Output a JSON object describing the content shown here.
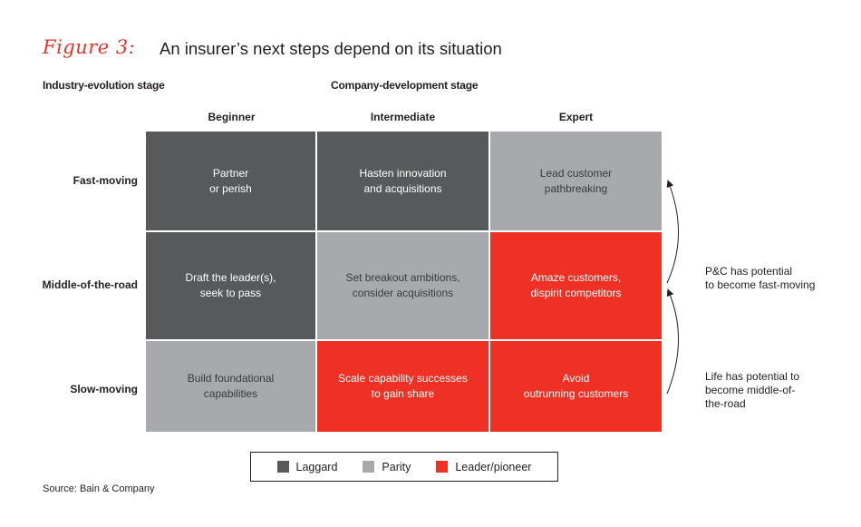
{
  "figure": {
    "label": "Figure 3:",
    "title": "An insurer’s next steps depend on its situation"
  },
  "axes": {
    "row_axis_title": "Industry-evolution stage",
    "col_axis_title": "Company-development stage",
    "columns": [
      "Beginner",
      "Intermediate",
      "Expert"
    ],
    "rows": [
      "Fast-moving",
      "Middle-of-the-road",
      "Slow-moving"
    ]
  },
  "matrix": [
    [
      {
        "line1": "Partner",
        "line2": "or perish",
        "category": "laggard"
      },
      {
        "line1": "Hasten innovation",
        "line2": "and acquisitions",
        "category": "laggard"
      },
      {
        "line1": "Lead customer",
        "line2": "pathbreaking",
        "category": "parity"
      }
    ],
    [
      {
        "line1": "Draft the leader(s),",
        "line2": "seek to pass",
        "category": "laggard"
      },
      {
        "line1": "Set breakout ambitions,",
        "line2": "consider acquisitions",
        "category": "parity"
      },
      {
        "line1": "Amaze customers,",
        "line2": "dispirit competitors",
        "category": "leader"
      }
    ],
    [
      {
        "line1": "Build foundational",
        "line2": "capabilities",
        "category": "parity"
      },
      {
        "line1": "Scale capability successes",
        "line2": "to gain share",
        "category": "leader"
      },
      {
        "line1": "Avoid",
        "line2": "outrunning customers",
        "category": "leader"
      }
    ]
  ],
  "annotations": {
    "pc": {
      "line1": "P&C has potential",
      "line2": "to become fast-moving"
    },
    "life": {
      "line1": "Life has potential to",
      "line2": "become middle-of-",
      "line3": "the-road"
    }
  },
  "legend": [
    {
      "key": "laggard",
      "label": "Laggard",
      "color": "#58595b"
    },
    {
      "key": "parity",
      "label": "Parity",
      "color": "#a7a9ac"
    },
    {
      "key": "leader",
      "label": "Leader/pioneer",
      "color": "#ee3124"
    }
  ],
  "colors": {
    "accent": "#e8322a",
    "laggard": "#58595b",
    "parity": "#a7a9ac",
    "leader": "#ee3124"
  },
  "source": "Source: Bain & Company"
}
